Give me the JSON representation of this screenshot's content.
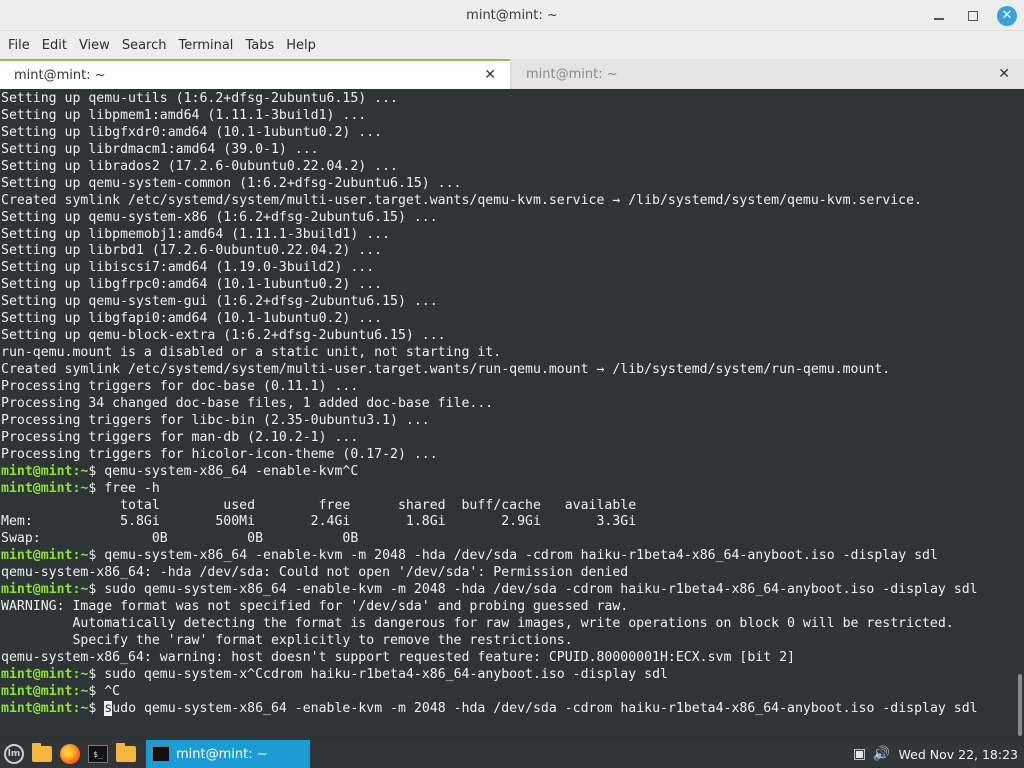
{
  "window": {
    "title": "mint@mint: ~"
  },
  "menu": [
    "File",
    "Edit",
    "View",
    "Search",
    "Terminal",
    "Tabs",
    "Help"
  ],
  "tabs": [
    {
      "label": "mint@mint: ~",
      "active": true
    },
    {
      "label": "mint@mint: ~",
      "active": false
    }
  ],
  "terminal": {
    "lines": [
      {
        "text": "Setting up qemu-utils (1:6.2+dfsg-2ubuntu6.15) ..."
      },
      {
        "text": "Setting up libpmem1:amd64 (1.11.1-3build1) ..."
      },
      {
        "text": "Setting up libgfxdr0:amd64 (10.1-1ubuntu0.2) ..."
      },
      {
        "text": "Setting up librdmacm1:amd64 (39.0-1) ..."
      },
      {
        "text": "Setting up librados2 (17.2.6-0ubuntu0.22.04.2) ..."
      },
      {
        "text": "Setting up qemu-system-common (1:6.2+dfsg-2ubuntu6.15) ..."
      },
      {
        "text": "Created symlink /etc/systemd/system/multi-user.target.wants/qemu-kvm.service → /lib/systemd/system/qemu-kvm.service."
      },
      {
        "text": "Setting up qemu-system-x86 (1:6.2+dfsg-2ubuntu6.15) ..."
      },
      {
        "text": "Setting up libpmemobj1:amd64 (1.11.1-3build1) ..."
      },
      {
        "text": "Setting up librbd1 (17.2.6-0ubuntu0.22.04.2) ..."
      },
      {
        "text": "Setting up libiscsi7:amd64 (1.19.0-3build2) ..."
      },
      {
        "text": "Setting up libgfrpc0:amd64 (10.1-1ubuntu0.2) ..."
      },
      {
        "text": "Setting up qemu-system-gui (1:6.2+dfsg-2ubuntu6.15) ..."
      },
      {
        "text": "Setting up libgfapi0:amd64 (10.1-1ubuntu0.2) ..."
      },
      {
        "text": "Setting up qemu-block-extra (1:6.2+dfsg-2ubuntu6.15) ..."
      },
      {
        "text": "run-qemu.mount is a disabled or a static unit, not starting it."
      },
      {
        "text": "Created symlink /etc/systemd/system/multi-user.target.wants/run-qemu.mount → /lib/systemd/system/run-qemu.mount."
      },
      {
        "text": "Processing triggers for doc-base (0.11.1) ..."
      },
      {
        "text": "Processing 34 changed doc-base files, 1 added doc-base file..."
      },
      {
        "text": "Processing triggers for libc-bin (2.35-0ubuntu3.1) ..."
      },
      {
        "text": "Processing triggers for man-db (2.10.2-1) ..."
      },
      {
        "text": "Processing triggers for hicolor-icon-theme (0.17-2) ..."
      },
      {
        "prompt": "mint@mint",
        "path": ":~$ ",
        "text": "qemu-system-x86_64 -enable-kvm^C"
      },
      {
        "prompt": "mint@mint",
        "path": ":~$ ",
        "text": "free -h"
      },
      {
        "text": "               total        used        free      shared  buff/cache   available"
      },
      {
        "text": "Mem:           5.8Gi       500Mi       2.4Gi       1.8Gi       2.9Gi       3.3Gi"
      },
      {
        "text": "Swap:              0B          0B          0B"
      },
      {
        "prompt": "mint@mint",
        "path": ":~$ ",
        "text": "qemu-system-x86_64 -enable-kvm -m 2048 -hda /dev/sda -cdrom haiku-r1beta4-x86_64-anyboot.iso -display sdl"
      },
      {
        "text": "qemu-system-x86_64: -hda /dev/sda: Could not open '/dev/sda': Permission denied"
      },
      {
        "prompt": "mint@mint",
        "path": ":~$ ",
        "text": "sudo qemu-system-x86_64 -enable-kvm -m 2048 -hda /dev/sda -cdrom haiku-r1beta4-x86_64-anyboot.iso -display sdl"
      },
      {
        "text": "WARNING: Image format was not specified for '/dev/sda' and probing guessed raw."
      },
      {
        "text": "         Automatically detecting the format is dangerous for raw images, write operations on block 0 will be restricted."
      },
      {
        "text": "         Specify the 'raw' format explicitly to remove the restrictions."
      },
      {
        "text": "qemu-system-x86_64: warning: host doesn't support requested feature: CPUID.80000001H:ECX.svm [bit 2]"
      },
      {
        "prompt": "mint@mint",
        "path": ":~$ ",
        "text": "sudo qemu-system-x^Ccdrom haiku-r1beta4-x86_64-anyboot.iso -display sdl"
      },
      {
        "prompt": "mint@mint",
        "path": ":~$ ",
        "text": "^C"
      }
    ],
    "current": {
      "prompt": "mint@mint",
      "path": ":~$ ",
      "cursor_char": "s",
      "rest": "udo qemu-system-x86_64 -enable-kvm -m 2048 -hda /dev/sda -cdrom haiku-r1beta4-x86_64-anyboot.iso -display sdl"
    }
  },
  "taskbar": {
    "task_window_label": "mint@mint: ~",
    "terminal_icon_text": "$_",
    "clock": "Wed Nov 22, 18:23"
  },
  "colors": {
    "terminal_bg": "#2f3436",
    "prompt_green": "#8ae234",
    "accent_blue": "#1c9cd4",
    "tab_accent": "#8ac056"
  },
  "icons": {
    "window_close": "close-icon",
    "window_minimize": "minimize-icon",
    "window_maximize": "maximize-icon",
    "tab_close": "close-icon",
    "menu": "mint-menu-icon",
    "show_desktop": "show-desktop-icon",
    "browser": "firefox-icon",
    "terminal": "terminal-icon",
    "files": "folder-icon",
    "tray_display": "display-icon",
    "tray_volume": "volume-icon"
  }
}
